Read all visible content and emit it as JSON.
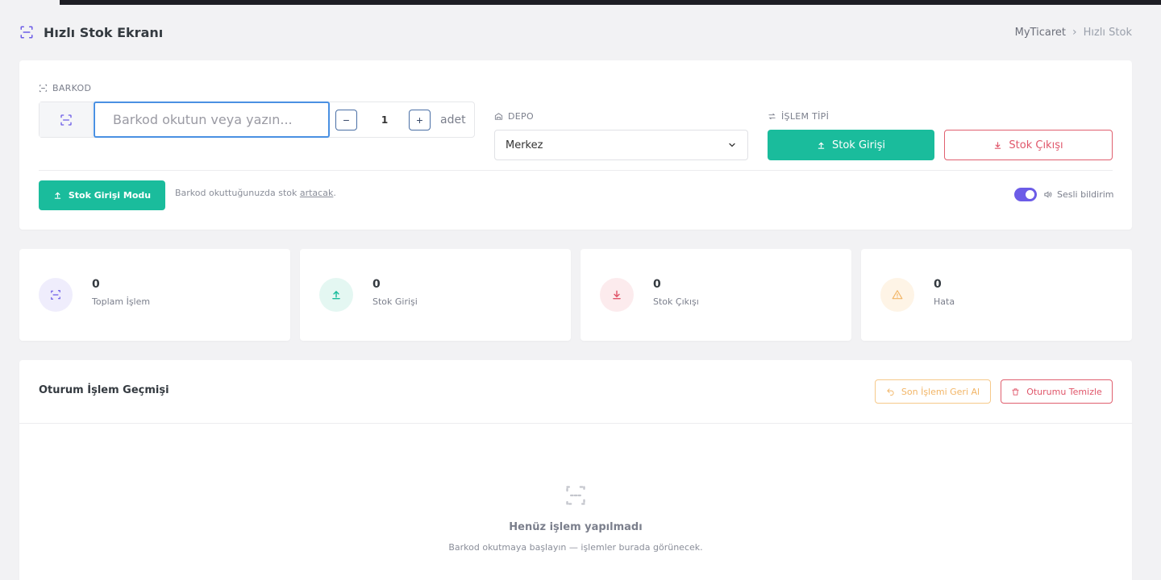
{
  "header": {
    "title": "Hızlı Stok Ekranı",
    "breadcrumb": {
      "root": "MyTicaret",
      "current": "Hızlı Stok"
    }
  },
  "form": {
    "barcode": {
      "label": "BARKOD",
      "placeholder": "Barkod okutun veya yazın...",
      "value": ""
    },
    "quantity": {
      "value": "1",
      "unit": "adet",
      "minus": "−",
      "plus": "+"
    },
    "depot": {
      "label": "DEPO",
      "selected": "Merkez"
    },
    "operation": {
      "label": "İŞLEM TİPİ",
      "in_label": "Stok Girişi",
      "out_label": "Stok Çıkışı"
    },
    "mode_button": "Stok Girişi Modu",
    "hint": {
      "text": "Barkod okuttuğunuzda stok ",
      "link": "artacak",
      "suffix": "."
    },
    "sound": {
      "label": "Sesli bildirim",
      "enabled": true
    }
  },
  "stats": [
    {
      "value": "0",
      "label": "Toplam İşlem",
      "icon": "scan-icon",
      "color": "#6c5ce7",
      "bg": "#efedfc"
    },
    {
      "value": "0",
      "label": "Stok Girişi",
      "icon": "upload-icon",
      "color": "#1abc9c",
      "bg": "#e4f7f2"
    },
    {
      "value": "0",
      "label": "Stok Çıkışı",
      "icon": "download-icon",
      "color": "#e0566a",
      "bg": "#fcebed"
    },
    {
      "value": "0",
      "label": "Hata",
      "icon": "warning-icon",
      "color": "#f2b566",
      "bg": "#fef4e6"
    }
  ],
  "history": {
    "title": "Oturum İşlem Geçmişi",
    "undo_label": "Son İşlemi Geri Al",
    "clear_label": "Oturumu Temizle",
    "empty_title": "Henüz işlem yapılmadı",
    "empty_subtitle": "Barkod okutmaya başlayın — işlemler burada görünecek."
  },
  "colors": {
    "accent": "#6c5ce7",
    "success": "#1abc9c",
    "danger": "#e0566a",
    "warning": "#f2b566"
  }
}
